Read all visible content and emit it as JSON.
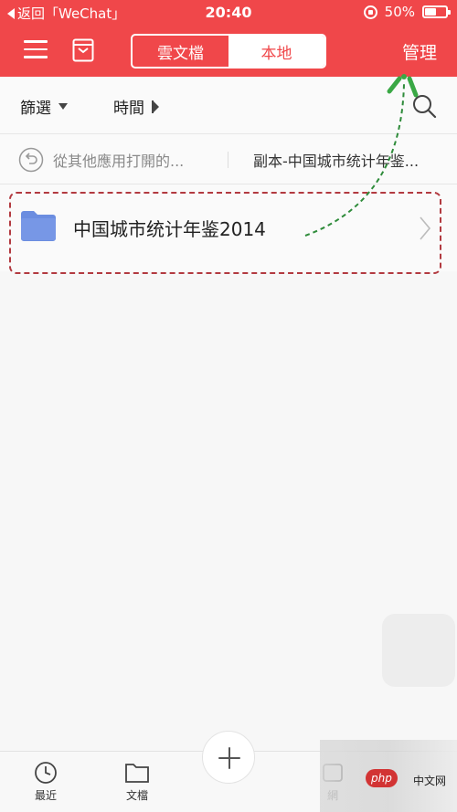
{
  "status_bar": {
    "back_label": "返回「WeChat」",
    "time": "20:40",
    "battery": "50%"
  },
  "nav": {
    "segments": [
      "雲文檔",
      "本地"
    ],
    "selected_segment": "本地",
    "manage_label": "管理"
  },
  "filter": {
    "filter_label": "篩選",
    "time_label": "時間"
  },
  "path": {
    "previous": "從其他應用打開的...",
    "current": "副本-中国城市统计年鉴..."
  },
  "files": [
    {
      "name": "中国城市统计年鉴2014",
      "type": "folder"
    }
  ],
  "tabbar": {
    "tabs": [
      {
        "label": "最近",
        "icon": "clock-icon"
      },
      {
        "label": "文檔",
        "icon": "folder-outline-icon"
      },
      {
        "label": "網",
        "icon": "cloud-icon"
      }
    ]
  },
  "watermark": {
    "logo": "php",
    "text": "中文网"
  },
  "colors": {
    "accent": "#f0474a",
    "folder": "#6b8de0",
    "highlight": "#b23a40",
    "arrow": "#2e8b3a"
  }
}
